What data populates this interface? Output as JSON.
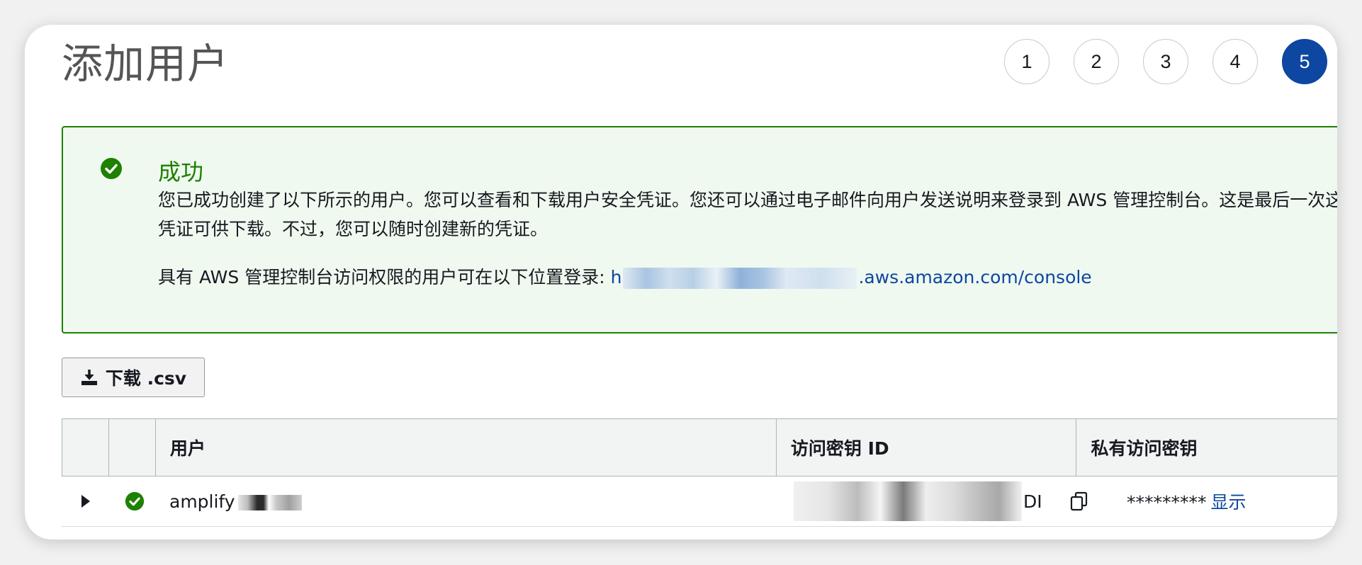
{
  "header": {
    "title": "添加用户",
    "steps": [
      "1",
      "2",
      "3",
      "4",
      "5"
    ],
    "active_step": "5"
  },
  "alert": {
    "icon": "check-circle-icon",
    "title": "成功",
    "message": "您已成功创建了以下所示的用户。您可以查看和下载用户安全凭证。您还可以通过电子邮件向用户发送说明来登录到 AWS 管理控制台。这是最后一次这些凭证可供下载。不过，您可以随时创建新的凭证。",
    "login_prefix": "具有 AWS 管理控制台访问权限的用户可在以下位置登录: ",
    "login_link_start": "h",
    "login_link_end": ".aws.amazon.com/console"
  },
  "download": {
    "label": "下载 .csv",
    "icon": "download-icon"
  },
  "table": {
    "columns": [
      "",
      "",
      "用户",
      "访问密钥 ID",
      "私有访问密钥"
    ],
    "rows": [
      {
        "user": "amplify",
        "access_key_suffix": "DI",
        "secret_masked": "*********",
        "show_label": "显示"
      }
    ]
  },
  "colors": {
    "success": "#1d8102",
    "link": "#0d47a1",
    "active_step": "#0d47a1"
  }
}
